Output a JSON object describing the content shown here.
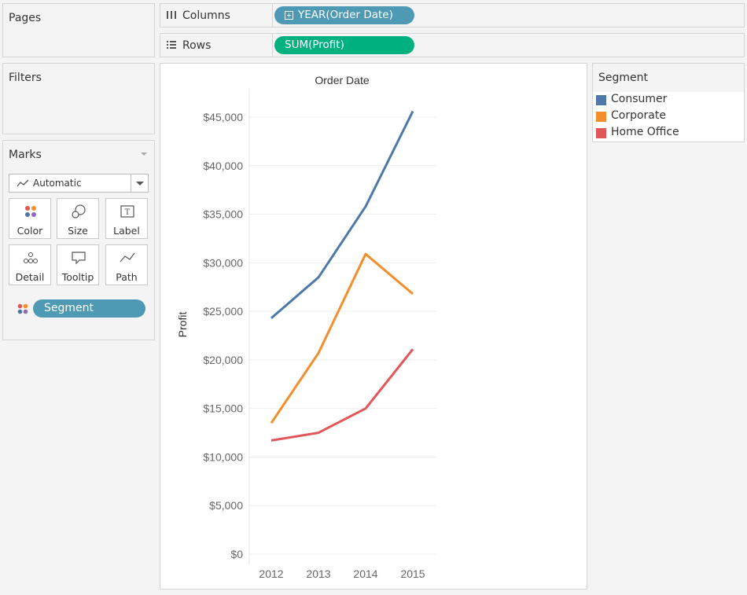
{
  "pages": {
    "title": "Pages"
  },
  "filters": {
    "title": "Filters"
  },
  "marks": {
    "title": "Marks",
    "mark_type": "Automatic",
    "cards": [
      {
        "label": "Color",
        "icon": "color-icon"
      },
      {
        "label": "Size",
        "icon": "size-icon"
      },
      {
        "label": "Label",
        "icon": "label-icon"
      },
      {
        "label": "Detail",
        "icon": "detail-icon"
      },
      {
        "label": "Tooltip",
        "icon": "tooltip-icon"
      },
      {
        "label": "Path",
        "icon": "path-icon"
      }
    ],
    "color_field": "Segment"
  },
  "shelves": {
    "columns": {
      "label": "Columns",
      "pill": "YEAR(Order Date)",
      "pill_color": "#4e9ab4"
    },
    "rows": {
      "label": "Rows",
      "pill": "SUM(Profit)",
      "pill_color": "#00b180"
    }
  },
  "legend": {
    "title": "Segment",
    "items": [
      {
        "label": "Consumer",
        "color": "#4e79a7"
      },
      {
        "label": "Corporate",
        "color": "#f28e2b"
      },
      {
        "label": "Home Office",
        "color": "#e15759"
      }
    ]
  },
  "chart_data": {
    "type": "line",
    "title": "Order Date",
    "xlabel": "",
    "ylabel": "Profit",
    "x": [
      "2012",
      "2013",
      "2014",
      "2015"
    ],
    "ylim": [
      0,
      47000
    ],
    "yticks": [
      0,
      5000,
      10000,
      15000,
      20000,
      25000,
      30000,
      35000,
      40000,
      45000
    ],
    "ytick_labels": [
      "$0",
      "$5,000",
      "$10,000",
      "$15,000",
      "$20,000",
      "$25,000",
      "$30,000",
      "$35,000",
      "$40,000",
      "$45,000"
    ],
    "grid": true,
    "series": [
      {
        "name": "Consumer",
        "color": "#4e79a7",
        "values": [
          24300,
          28500,
          35800,
          45600
        ]
      },
      {
        "name": "Corporate",
        "color": "#f28e2b",
        "values": [
          13500,
          20700,
          30900,
          26800
        ]
      },
      {
        "name": "Home Office",
        "color": "#e15759",
        "values": [
          11700,
          12500,
          15000,
          21100
        ]
      }
    ]
  }
}
